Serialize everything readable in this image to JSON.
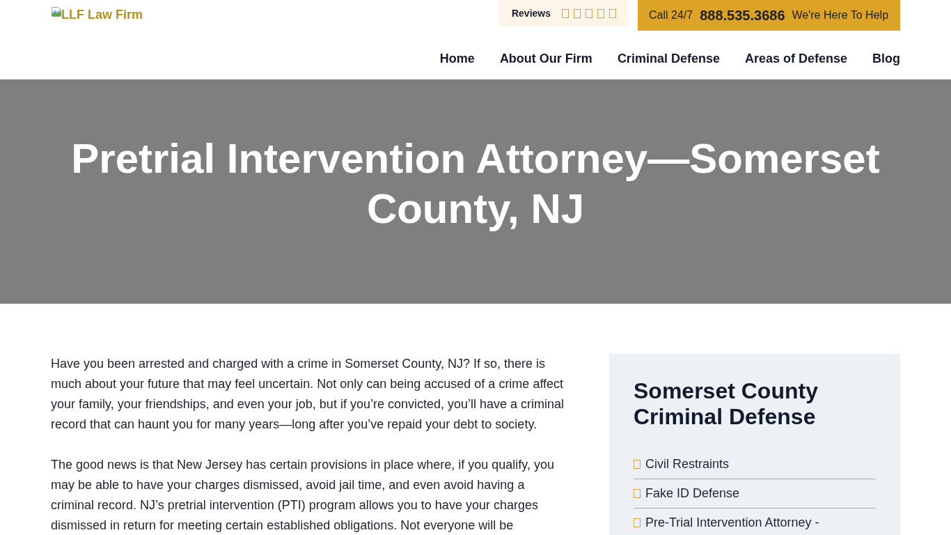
{
  "header": {
    "logo": {
      "alt_text": "LLF Law Firm"
    },
    "reviews": {
      "label": "Reviews"
    },
    "call": {
      "prefix": "Call 24/7",
      "phone": "888.535.3686",
      "tagline": "We're Here To Help"
    },
    "nav": [
      "Home",
      "About Our Firm",
      "Criminal Defense",
      "Areas of Defense",
      "Blog"
    ]
  },
  "hero": {
    "title": "Pretrial Intervention Attorney—Somerset County, NJ"
  },
  "article": {
    "paragraphs": [
      "Have you been arrested and charged with a crime in Somerset County, NJ? If so, there is much about your future that may feel uncertain. Not only can being accused of a crime affect your family, your friendships, and even your job, but if you’re convicted, you’ll have a criminal record that can haunt you for many years—long after you’ve repaid your debt to society.",
      "The good news is that New Jersey has certain provisions in place where, if you qualify, you may be able to have your charges dismissed, avoid jail time, and even avoid having a criminal record. NJ’s pretrial intervention (PTI) program allows you to have your charges dismissed in return for meeting certain established obligations. Not everyone will be"
    ]
  },
  "sidebar": {
    "title": "Somerset County Criminal Defense",
    "items": [
      "Civil Restraints",
      "Fake ID Defense",
      "Pre-Trial Intervention Attorney -"
    ]
  }
}
